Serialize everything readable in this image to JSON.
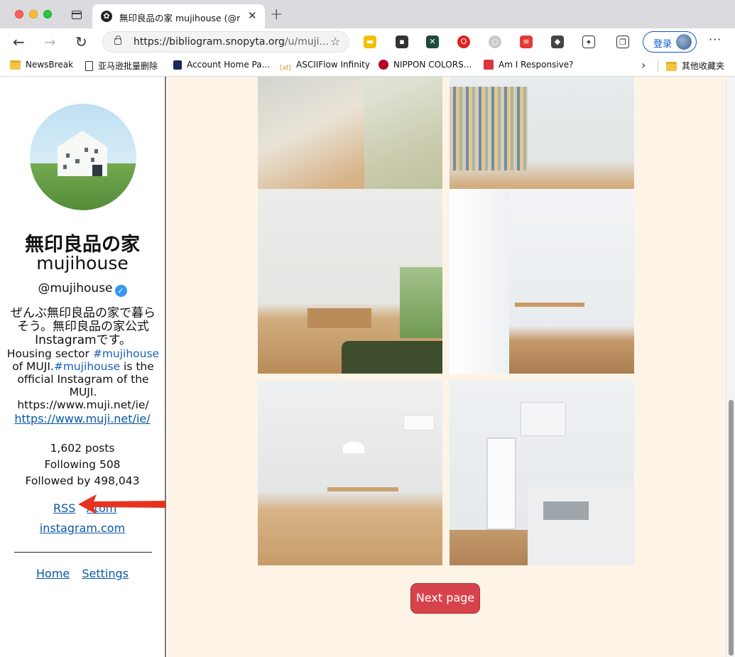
{
  "browser": {
    "tab_title": "無印良品の家 mujihouse (@mu",
    "url_host": "https://bibliogram.snopyta.org",
    "url_path": "/u/muji...",
    "login_label": "登录",
    "bookmarks": [
      {
        "label": "NewsBreak",
        "icon": "folder-icon"
      },
      {
        "label": "亚马逊批量删除",
        "icon": "document-icon"
      },
      {
        "label": "Account Home Pa...",
        "icon": "bookmark-icon"
      },
      {
        "label": "ASCIIFlow Infinity",
        "icon": "asciiflow-icon"
      },
      {
        "label": "NIPPON COLORS...",
        "icon": "circle-icon"
      },
      {
        "label": "Am I Responsive?",
        "icon": "responsive-icon"
      }
    ],
    "other_bookmarks": "其他收藏夹"
  },
  "profile": {
    "display_name": "無印良品の家",
    "username": "mujihouse",
    "handle": "@mujihouse",
    "bio_jp": "ぜんぶ無印良品の家で暮らそう。無印良品の家公式Instagramです。",
    "bio_en_1": "Housing sector ",
    "bio_tag_1": "#mujihouse",
    "bio_en_2": " of MUJI.",
    "bio_tag_2": "#mujihouse",
    "bio_en_3": " is the official Instagram of the MUJI. https://www.muji.net/ie/",
    "external_link": "https://www.muji.net/ie/",
    "posts": "1,602 posts",
    "following": "Following 508",
    "followers": "Followed by 498,043",
    "rss_label": "RSS",
    "atom_label": "Atom",
    "instagram_label": "instagram.com",
    "home_label": "Home",
    "settings_label": "Settings"
  },
  "gallery": {
    "next_page_label": "Next page"
  },
  "colors": {
    "page_bg": "#fdf4e7",
    "link": "#0a58a8",
    "button": "#d8434b",
    "annotation_arrow": "#e8321e"
  }
}
